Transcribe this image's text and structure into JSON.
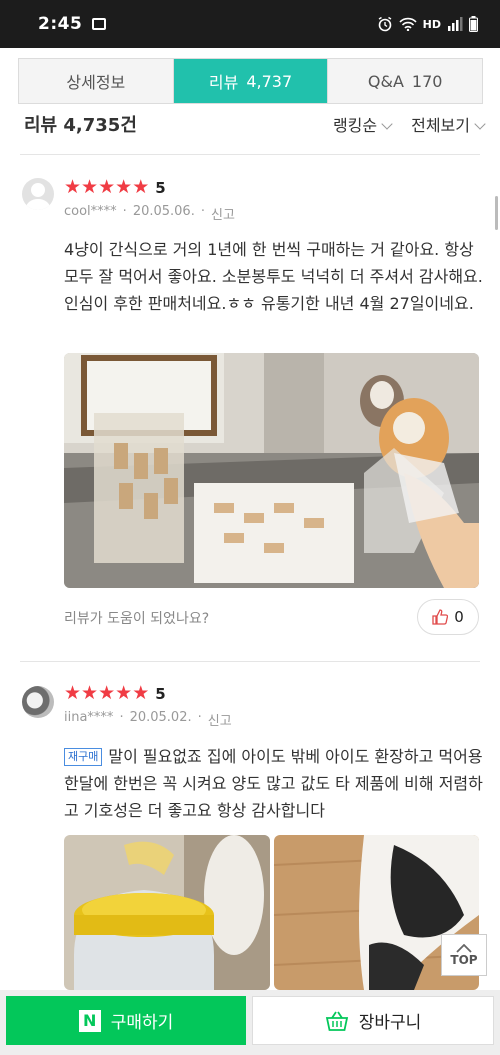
{
  "status_bar": {
    "time": "2:45",
    "hd_label": "HD"
  },
  "tabs": [
    {
      "label": "상세정보",
      "count": ""
    },
    {
      "label": "리뷰",
      "count": "4,737"
    },
    {
      "label": "Q&A",
      "count": "170"
    }
  ],
  "review_header": {
    "title": "리뷰 4,735건",
    "sort": "랭킹순",
    "filter": "전체보기"
  },
  "reviews": [
    {
      "score": "5",
      "user": "cool****",
      "date": "20.05.06.",
      "report": "신고",
      "badge": "",
      "text": "4냥이 간식으로 거의 1년에 한 번씩 구매하는 거 같아요. 항상 모두 잘 먹어서 좋아요. 소분봉투도 넉넉히 더 주셔서 감사해요. 인심이 후한 판매처네요.ㅎㅎ 유통기한 내년 4월 27일이네요.",
      "helpful_question": "리뷰가 도움이 되었나요?",
      "likes": "0"
    },
    {
      "score": "5",
      "user": "iina****",
      "date": "20.05.02.",
      "report": "신고",
      "badge": "재구매",
      "text": "말이 필요없죠 집에 아이도 밖베 아이도 환장하고 먹어용 한달에 한번은 꼭 시켜요 양도 많고 값도 타 제품에 비해 저렴하고 기호성은 더 좋고요 항상 감사합니다",
      "helpful_question": "",
      "likes": ""
    }
  ],
  "top_button": "TOP",
  "bottom_bar": {
    "buy_label": "구매하기",
    "buy_logo": "N",
    "cart_label": "장바구니"
  },
  "colors": {
    "accent": "#21c1ac",
    "star": "#f03c44",
    "buy": "#03c75a"
  }
}
